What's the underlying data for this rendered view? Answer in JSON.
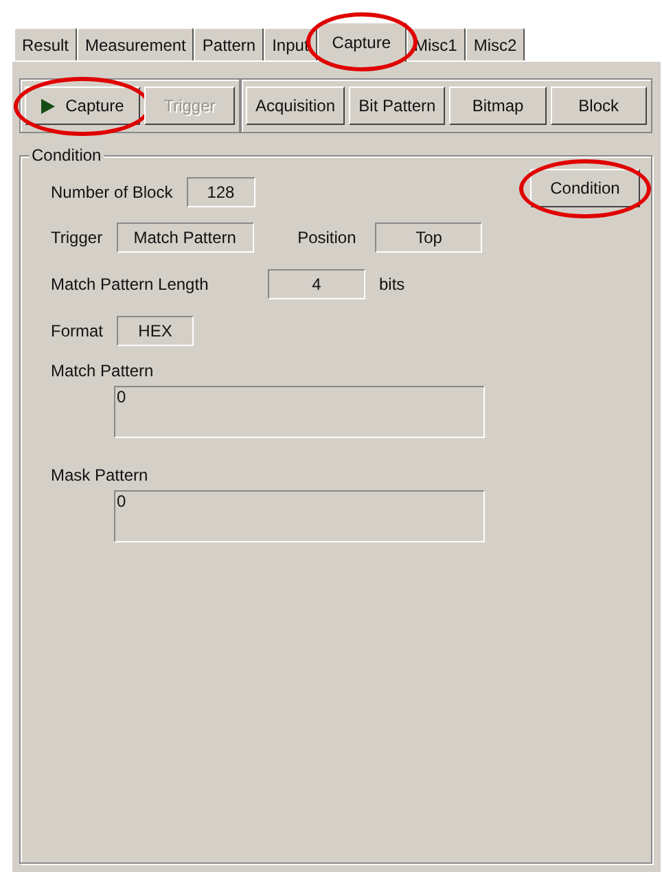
{
  "tabs": [
    {
      "label": "Result",
      "selected": false,
      "highlighted": false
    },
    {
      "label": "Measurement",
      "selected": false,
      "highlighted": false
    },
    {
      "label": "Pattern",
      "selected": false,
      "highlighted": false
    },
    {
      "label": "Input",
      "selected": false,
      "highlighted": false
    },
    {
      "label": "Capture",
      "selected": true,
      "highlighted": true
    },
    {
      "label": "Misc1",
      "selected": false,
      "highlighted": false
    },
    {
      "label": "Misc2",
      "selected": false,
      "highlighted": false
    }
  ],
  "toolbar": {
    "left": [
      {
        "label": "Capture",
        "kind": "play",
        "disabled": false,
        "highlighted": true
      },
      {
        "label": "Trigger",
        "kind": "plain",
        "disabled": true,
        "highlighted": false
      }
    ],
    "right": [
      {
        "label": "Acquisition",
        "disabled": false,
        "highlighted": false
      },
      {
        "label": "Bit Pattern",
        "disabled": false,
        "highlighted": false
      },
      {
        "label": "Bitmap",
        "disabled": false,
        "highlighted": false
      },
      {
        "label": "Block",
        "disabled": false,
        "highlighted": false
      }
    ]
  },
  "condition_group": {
    "title": "Condition",
    "condition_button": {
      "label": "Condition",
      "highlighted": true
    },
    "number_of_block": {
      "label": "Number of Block",
      "value": "128"
    },
    "trigger": {
      "label": "Trigger",
      "value": "Match Pattern"
    },
    "position": {
      "label": "Position",
      "value": "Top"
    },
    "match_pattern_length": {
      "label": "Match Pattern Length",
      "value": "4",
      "unit": "bits"
    },
    "format": {
      "label": "Format",
      "value": "HEX"
    },
    "match_pattern": {
      "label": "Match Pattern",
      "value": "0"
    },
    "mask_pattern": {
      "label": "Mask Pattern",
      "value": "0"
    }
  }
}
